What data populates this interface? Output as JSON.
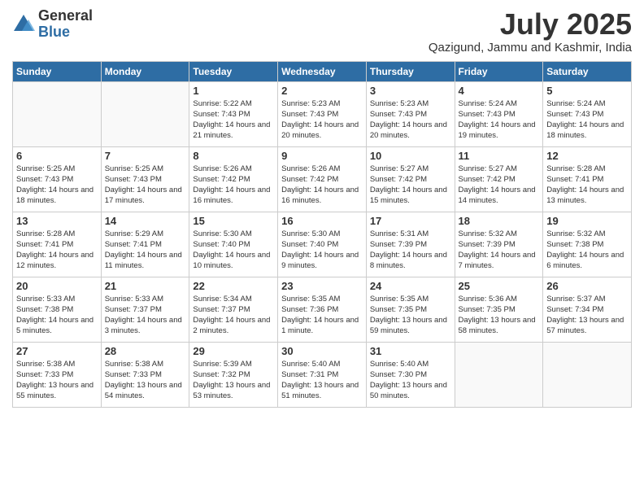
{
  "logo": {
    "general": "General",
    "blue": "Blue"
  },
  "title": "July 2025",
  "location": "Qazigund, Jammu and Kashmir, India",
  "headers": [
    "Sunday",
    "Monday",
    "Tuesday",
    "Wednesday",
    "Thursday",
    "Friday",
    "Saturday"
  ],
  "weeks": [
    [
      {
        "day": "",
        "sunrise": "",
        "sunset": "",
        "daylight": ""
      },
      {
        "day": "",
        "sunrise": "",
        "sunset": "",
        "daylight": ""
      },
      {
        "day": "1",
        "sunrise": "Sunrise: 5:22 AM",
        "sunset": "Sunset: 7:43 PM",
        "daylight": "Daylight: 14 hours and 21 minutes."
      },
      {
        "day": "2",
        "sunrise": "Sunrise: 5:23 AM",
        "sunset": "Sunset: 7:43 PM",
        "daylight": "Daylight: 14 hours and 20 minutes."
      },
      {
        "day": "3",
        "sunrise": "Sunrise: 5:23 AM",
        "sunset": "Sunset: 7:43 PM",
        "daylight": "Daylight: 14 hours and 20 minutes."
      },
      {
        "day": "4",
        "sunrise": "Sunrise: 5:24 AM",
        "sunset": "Sunset: 7:43 PM",
        "daylight": "Daylight: 14 hours and 19 minutes."
      },
      {
        "day": "5",
        "sunrise": "Sunrise: 5:24 AM",
        "sunset": "Sunset: 7:43 PM",
        "daylight": "Daylight: 14 hours and 18 minutes."
      }
    ],
    [
      {
        "day": "6",
        "sunrise": "Sunrise: 5:25 AM",
        "sunset": "Sunset: 7:43 PM",
        "daylight": "Daylight: 14 hours and 18 minutes."
      },
      {
        "day": "7",
        "sunrise": "Sunrise: 5:25 AM",
        "sunset": "Sunset: 7:43 PM",
        "daylight": "Daylight: 14 hours and 17 minutes."
      },
      {
        "day": "8",
        "sunrise": "Sunrise: 5:26 AM",
        "sunset": "Sunset: 7:42 PM",
        "daylight": "Daylight: 14 hours and 16 minutes."
      },
      {
        "day": "9",
        "sunrise": "Sunrise: 5:26 AM",
        "sunset": "Sunset: 7:42 PM",
        "daylight": "Daylight: 14 hours and 16 minutes."
      },
      {
        "day": "10",
        "sunrise": "Sunrise: 5:27 AM",
        "sunset": "Sunset: 7:42 PM",
        "daylight": "Daylight: 14 hours and 15 minutes."
      },
      {
        "day": "11",
        "sunrise": "Sunrise: 5:27 AM",
        "sunset": "Sunset: 7:42 PM",
        "daylight": "Daylight: 14 hours and 14 minutes."
      },
      {
        "day": "12",
        "sunrise": "Sunrise: 5:28 AM",
        "sunset": "Sunset: 7:41 PM",
        "daylight": "Daylight: 14 hours and 13 minutes."
      }
    ],
    [
      {
        "day": "13",
        "sunrise": "Sunrise: 5:28 AM",
        "sunset": "Sunset: 7:41 PM",
        "daylight": "Daylight: 14 hours and 12 minutes."
      },
      {
        "day": "14",
        "sunrise": "Sunrise: 5:29 AM",
        "sunset": "Sunset: 7:41 PM",
        "daylight": "Daylight: 14 hours and 11 minutes."
      },
      {
        "day": "15",
        "sunrise": "Sunrise: 5:30 AM",
        "sunset": "Sunset: 7:40 PM",
        "daylight": "Daylight: 14 hours and 10 minutes."
      },
      {
        "day": "16",
        "sunrise": "Sunrise: 5:30 AM",
        "sunset": "Sunset: 7:40 PM",
        "daylight": "Daylight: 14 hours and 9 minutes."
      },
      {
        "day": "17",
        "sunrise": "Sunrise: 5:31 AM",
        "sunset": "Sunset: 7:39 PM",
        "daylight": "Daylight: 14 hours and 8 minutes."
      },
      {
        "day": "18",
        "sunrise": "Sunrise: 5:32 AM",
        "sunset": "Sunset: 7:39 PM",
        "daylight": "Daylight: 14 hours and 7 minutes."
      },
      {
        "day": "19",
        "sunrise": "Sunrise: 5:32 AM",
        "sunset": "Sunset: 7:38 PM",
        "daylight": "Daylight: 14 hours and 6 minutes."
      }
    ],
    [
      {
        "day": "20",
        "sunrise": "Sunrise: 5:33 AM",
        "sunset": "Sunset: 7:38 PM",
        "daylight": "Daylight: 14 hours and 5 minutes."
      },
      {
        "day": "21",
        "sunrise": "Sunrise: 5:33 AM",
        "sunset": "Sunset: 7:37 PM",
        "daylight": "Daylight: 14 hours and 3 minutes."
      },
      {
        "day": "22",
        "sunrise": "Sunrise: 5:34 AM",
        "sunset": "Sunset: 7:37 PM",
        "daylight": "Daylight: 14 hours and 2 minutes."
      },
      {
        "day": "23",
        "sunrise": "Sunrise: 5:35 AM",
        "sunset": "Sunset: 7:36 PM",
        "daylight": "Daylight: 14 hours and 1 minute."
      },
      {
        "day": "24",
        "sunrise": "Sunrise: 5:35 AM",
        "sunset": "Sunset: 7:35 PM",
        "daylight": "Daylight: 13 hours and 59 minutes."
      },
      {
        "day": "25",
        "sunrise": "Sunrise: 5:36 AM",
        "sunset": "Sunset: 7:35 PM",
        "daylight": "Daylight: 13 hours and 58 minutes."
      },
      {
        "day": "26",
        "sunrise": "Sunrise: 5:37 AM",
        "sunset": "Sunset: 7:34 PM",
        "daylight": "Daylight: 13 hours and 57 minutes."
      }
    ],
    [
      {
        "day": "27",
        "sunrise": "Sunrise: 5:38 AM",
        "sunset": "Sunset: 7:33 PM",
        "daylight": "Daylight: 13 hours and 55 minutes."
      },
      {
        "day": "28",
        "sunrise": "Sunrise: 5:38 AM",
        "sunset": "Sunset: 7:33 PM",
        "daylight": "Daylight: 13 hours and 54 minutes."
      },
      {
        "day": "29",
        "sunrise": "Sunrise: 5:39 AM",
        "sunset": "Sunset: 7:32 PM",
        "daylight": "Daylight: 13 hours and 53 minutes."
      },
      {
        "day": "30",
        "sunrise": "Sunrise: 5:40 AM",
        "sunset": "Sunset: 7:31 PM",
        "daylight": "Daylight: 13 hours and 51 minutes."
      },
      {
        "day": "31",
        "sunrise": "Sunrise: 5:40 AM",
        "sunset": "Sunset: 7:30 PM",
        "daylight": "Daylight: 13 hours and 50 minutes."
      },
      {
        "day": "",
        "sunrise": "",
        "sunset": "",
        "daylight": ""
      },
      {
        "day": "",
        "sunrise": "",
        "sunset": "",
        "daylight": ""
      }
    ]
  ]
}
